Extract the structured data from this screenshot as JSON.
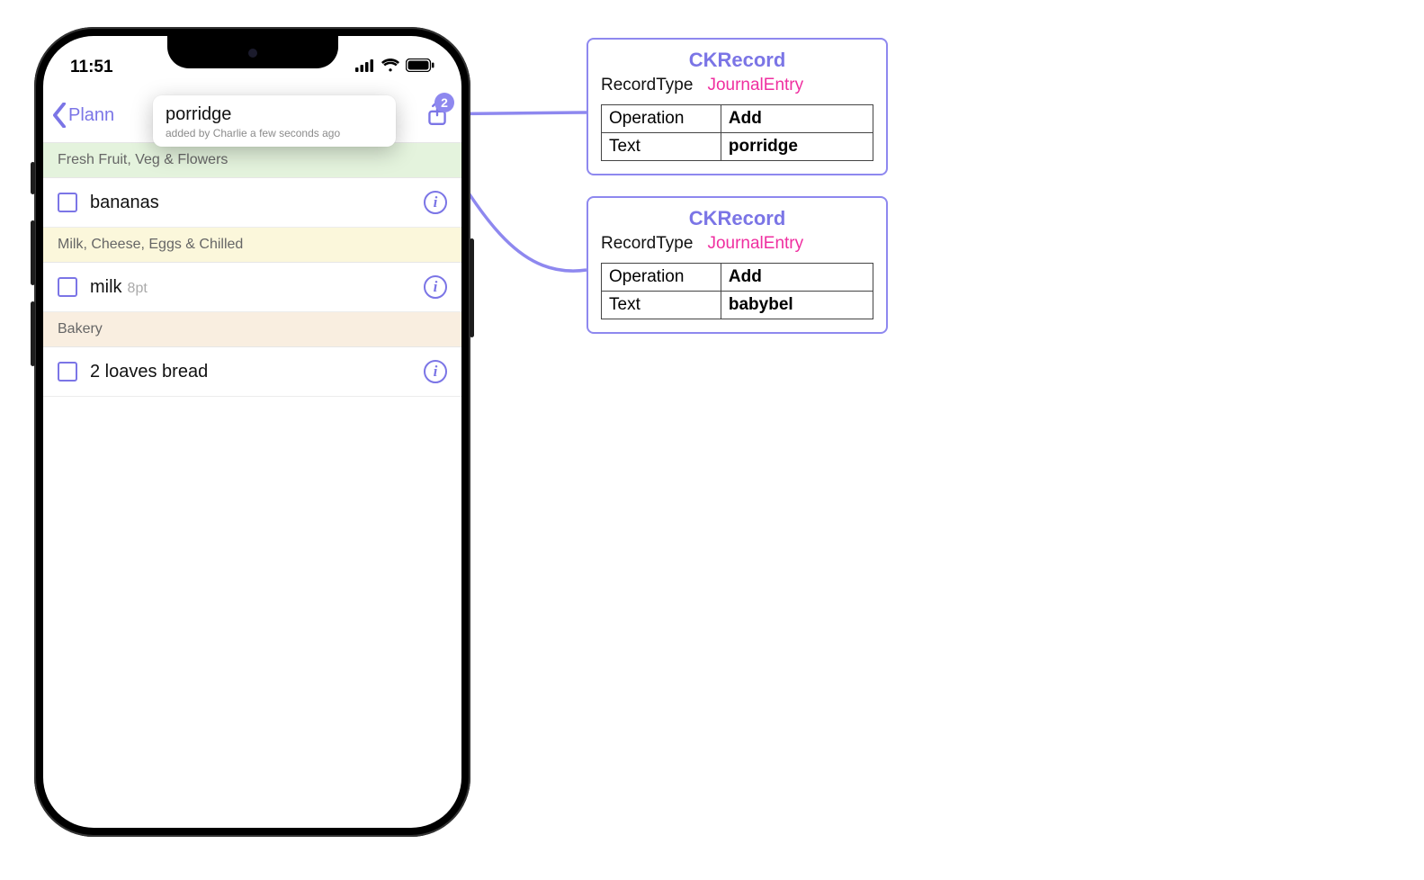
{
  "status": {
    "time": "11:51"
  },
  "nav": {
    "back_label": "Plann"
  },
  "toast": {
    "title": "porridge",
    "subtitle": "added by Charlie a few seconds ago",
    "badge": "2"
  },
  "sections": [
    {
      "title": "Fresh Fruit, Veg & Flowers",
      "cls": "sec-green",
      "items": [
        {
          "text": "bananas",
          "sub": ""
        }
      ]
    },
    {
      "title": "Milk, Cheese, Eggs & Chilled",
      "cls": "sec-yellow",
      "items": [
        {
          "text": "milk",
          "sub": "8pt"
        }
      ]
    },
    {
      "title": "Bakery",
      "cls": "sec-orange",
      "items": [
        {
          "text": "2 loaves bread",
          "sub": ""
        }
      ]
    }
  ],
  "records": [
    {
      "title": "CKRecord",
      "recordTypeLabel": "RecordType",
      "recordTypeValue": "JournalEntry",
      "rows": [
        {
          "k": "Operation",
          "v": "Add"
        },
        {
          "k": "Text",
          "v": "porridge"
        }
      ]
    },
    {
      "title": "CKRecord",
      "recordTypeLabel": "RecordType",
      "recordTypeValue": "JournalEntry",
      "rows": [
        {
          "k": "Operation",
          "v": "Add"
        },
        {
          "k": "Text",
          "v": "babybel"
        }
      ]
    }
  ]
}
